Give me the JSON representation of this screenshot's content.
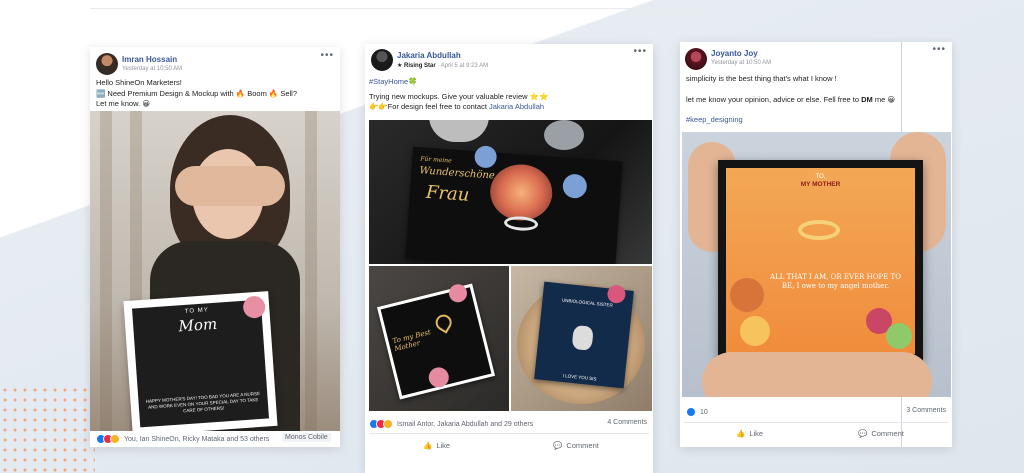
{
  "posts": [
    {
      "author": "Imran Hossain",
      "meta": "Yesterday at 10:50 AM",
      "lines": [
        "Hello ShineOn Marketers!",
        "🆕 Need Premium Design & Mockup with 🔥 Boom 🔥 Sell?",
        "Let me know. 😀"
      ],
      "image": {
        "box_sub": "TO MY",
        "box_title": "Mom",
        "box_text": "HAPPY MOTHER'S DAY! TOO BAD YOU ARE A NURSE AND WORK EVEN ON YOUR SPECIAL DAY TO TAKE CARE OF OTHERS!"
      },
      "reactions": "You, Ian ShineOn, Ricky Mataka and 53 others",
      "page_chip": "Monos Cobile"
    },
    {
      "author": "Jakaria Abdullah",
      "badge": "★ Rising Star",
      "meta": "April 5 at 9:23 AM",
      "hashtag": "#StayHome🍀",
      "lines": [
        "Trying new mockups. Give your valuable review ⭐⭐",
        "👉👉For design feel free to contact"
      ],
      "mention": "Jakaria Abdullah",
      "image": {
        "script1": "Für meine",
        "script2": "Wunderschöne",
        "script3": "Frau",
        "card_b": "To my Best Mother",
        "card_c": "UNBIOLOGICAL SISTER",
        "card_c2": "I LOVE YOU SIS"
      },
      "reactions": "Ismail Antor, Jakaria Abdullah and 29 others",
      "comments": "4 Comments",
      "actions": [
        "Like",
        "Comment"
      ]
    },
    {
      "author": "Joyanto Joy",
      "meta": "Yesterday at 10:50 AM",
      "lines": [
        "simplicity is the best thing that's what I know !"
      ],
      "line2_pre": "let me know your opinion, advice or else. Fell free to ",
      "line2_bold": "DM",
      "line2_post": " me 😀",
      "hashtag": "#keep_designing",
      "image": {
        "to": "TO,",
        "mother": "MY MOTHER",
        "msg": "ALL THAT I AM, OR EVER HOPE TO BE, I owe to my angel mother."
      },
      "reaction_count": "10",
      "comments": "3 Comments",
      "actions": [
        "Like",
        "Comment"
      ]
    }
  ],
  "colors": {
    "link": "#385898",
    "like_blue": "#1877f2",
    "love_red": "#f02849",
    "haha_yellow": "#f7b125"
  },
  "icons": [
    "more-icon",
    "like-icon",
    "comment-icon"
  ]
}
